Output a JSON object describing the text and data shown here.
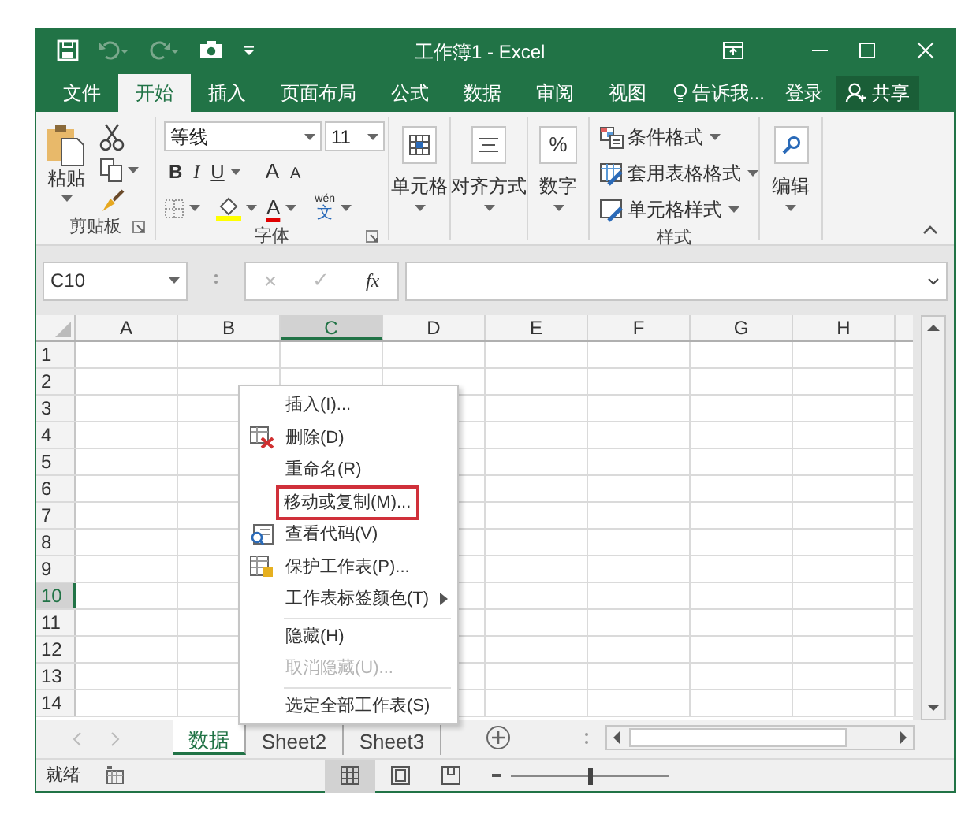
{
  "window": {
    "title": "工作簿1 - Excel"
  },
  "menu_tabs": [
    {
      "label": "文件",
      "selected": false
    },
    {
      "label": "开始",
      "selected": true
    },
    {
      "label": "插入",
      "selected": false
    },
    {
      "label": "页面布局",
      "selected": false
    },
    {
      "label": "公式",
      "selected": false
    },
    {
      "label": "数据",
      "selected": false
    },
    {
      "label": "审阅",
      "selected": false
    },
    {
      "label": "视图",
      "selected": false
    }
  ],
  "tell_me": "告诉我...",
  "sign_in": "登录",
  "share": "共享",
  "ribbon": {
    "clipboard": {
      "paste": "粘贴",
      "label": "剪贴板"
    },
    "font": {
      "name": "等线",
      "size": "11",
      "bold": "B",
      "italic": "I",
      "underline": "U",
      "grow": "A",
      "shrink": "A",
      "font_color_label": "A",
      "phonetic_top": "wén",
      "phonetic_bottom": "文",
      "label": "字体"
    },
    "cells": "单元格",
    "alignment": "对齐方式",
    "number": {
      "symbol": "%",
      "label": "数字"
    },
    "styles": {
      "items": [
        "条件格式",
        "套用表格格式",
        "单元格样式"
      ],
      "label": "样式"
    },
    "editing": "编辑"
  },
  "formula_bar": {
    "name_box": "C10",
    "cancel": "×",
    "enter": "✓",
    "function": "fx"
  },
  "sheet": {
    "columns": [
      {
        "label": "A",
        "selected": false
      },
      {
        "label": "B",
        "selected": false
      },
      {
        "label": "C",
        "selected": true
      },
      {
        "label": "D",
        "selected": false
      },
      {
        "label": "E",
        "selected": false
      },
      {
        "label": "F",
        "selected": false
      },
      {
        "label": "G",
        "selected": false
      },
      {
        "label": "H",
        "selected": false
      }
    ],
    "rows": [
      {
        "label": "1",
        "selected": false
      },
      {
        "label": "2",
        "selected": false
      },
      {
        "label": "3",
        "selected": false
      },
      {
        "label": "4",
        "selected": false
      },
      {
        "label": "5",
        "selected": false
      },
      {
        "label": "6",
        "selected": false
      },
      {
        "label": "7",
        "selected": false
      },
      {
        "label": "8",
        "selected": false
      },
      {
        "label": "9",
        "selected": false
      },
      {
        "label": "10",
        "selected": true
      },
      {
        "label": "11",
        "selected": false
      },
      {
        "label": "12",
        "selected": false
      },
      {
        "label": "13",
        "selected": false
      },
      {
        "label": "14",
        "selected": false
      }
    ]
  },
  "context_menu": [
    {
      "kind": "item",
      "label": "插入(I)...",
      "icon": false,
      "disabled": false,
      "highlighted": false,
      "submenu": false
    },
    {
      "kind": "item",
      "label": "删除(D)",
      "icon": true,
      "disabled": false,
      "highlighted": false,
      "submenu": false
    },
    {
      "kind": "item",
      "label": "重命名(R)",
      "icon": false,
      "disabled": false,
      "highlighted": false,
      "submenu": false
    },
    {
      "kind": "item",
      "label": "移动或复制(M)...",
      "icon": false,
      "disabled": false,
      "highlighted": true,
      "submenu": false
    },
    {
      "kind": "item",
      "label": "查看代码(V)",
      "icon": true,
      "disabled": false,
      "highlighted": false,
      "submenu": false
    },
    {
      "kind": "item",
      "label": "保护工作表(P)...",
      "icon": true,
      "disabled": false,
      "highlighted": false,
      "submenu": false
    },
    {
      "kind": "item",
      "label": "工作表标签颜色(T)",
      "icon": false,
      "disabled": false,
      "highlighted": false,
      "submenu": true
    },
    {
      "kind": "separator"
    },
    {
      "kind": "item",
      "label": "隐藏(H)",
      "icon": false,
      "disabled": false,
      "highlighted": false,
      "submenu": false
    },
    {
      "kind": "item",
      "label": "取消隐藏(U)...",
      "icon": false,
      "disabled": true,
      "highlighted": false,
      "submenu": false
    },
    {
      "kind": "separator"
    },
    {
      "kind": "item",
      "label": "选定全部工作表(S)",
      "icon": false,
      "disabled": false,
      "highlighted": false,
      "submenu": false
    }
  ],
  "sheet_tabs": [
    {
      "label": "数据",
      "selected": true
    },
    {
      "label": "Sheet2",
      "selected": false
    },
    {
      "label": "Sheet3",
      "selected": false
    }
  ],
  "status_bar": {
    "status": "就绪",
    "views": [
      {
        "selected": true
      },
      {
        "selected": false
      },
      {
        "selected": false
      }
    ],
    "zoom": {
      "level": 0.5
    }
  }
}
